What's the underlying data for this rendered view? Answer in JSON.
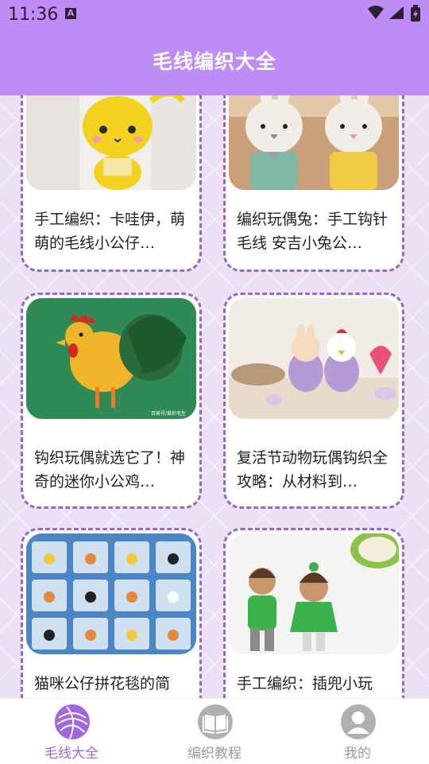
{
  "status_bar": {
    "time": "11:36",
    "notification_icon": "A"
  },
  "header": {
    "title": "毛线编织大全"
  },
  "cards": [
    {
      "title": "手工编织：卡哇伊，萌萌的毛线小公仔…",
      "image": "yellow-crochet-dragon"
    },
    {
      "title": "编织玩偶兔：手工钩针毛线 安吉小兔公…",
      "image": "crochet-bunny-pair"
    },
    {
      "title": "钩织玩偶就选它了！神奇的迷你小公鸡…",
      "image": "crochet-rooster",
      "image_watermark": "百家号/爱织毛生"
    },
    {
      "title": "复活节动物玩偶钩织全攻略：从材料到…",
      "image": "easter-chick-dolls"
    },
    {
      "title": "猫咪公仔拼花毯的简",
      "image": "cat-paw-granny-blanket"
    },
    {
      "title": "手工编织：插兜小玩",
      "image": "knitted-boy-girl-dolls"
    }
  ],
  "bottom_nav": {
    "items": [
      {
        "label": "毛线大全",
        "icon": "yarn-ball-icon",
        "active": true
      },
      {
        "label": "编织教程",
        "icon": "book-icon",
        "active": false
      },
      {
        "label": "我的",
        "icon": "user-icon",
        "active": false
      }
    ]
  },
  "colors": {
    "primary": "#bf8cf5",
    "accent": "#9b63d8",
    "nav_active": "#a466e0",
    "nav_inactive": "#9a9a9a"
  }
}
